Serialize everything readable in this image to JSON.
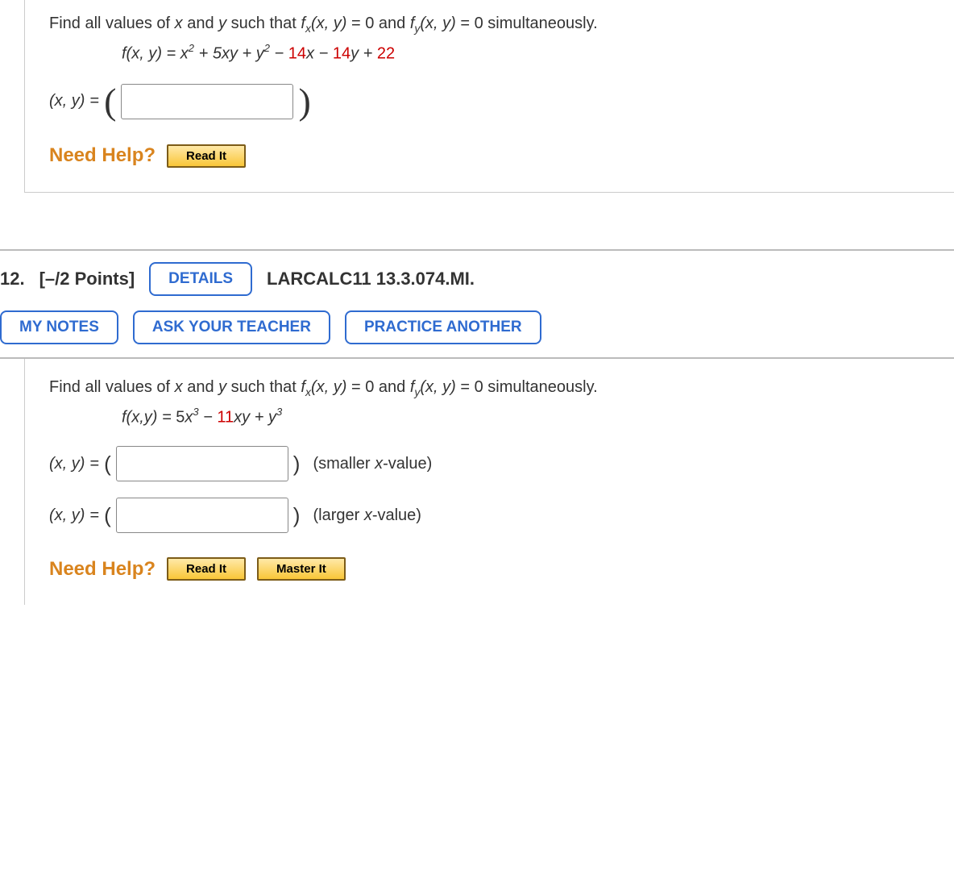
{
  "q11": {
    "prompt_before": "Find all values of ",
    "var_x": "x",
    "and1": " and ",
    "var_y": "y",
    "prompt_mid": " such that ",
    "fx": "f",
    "fx_sub": "x",
    "args": "(x, y)",
    "eq0_1": " = 0 and ",
    "fy": "f",
    "fy_sub": "y",
    "eq0_2": " = 0 simultaneously.",
    "eq_lhs": "f(x, y) = ",
    "eq_term1": "x",
    "eq_term2": " + 5xy + ",
    "eq_term3": "y",
    "eq_term4": " − ",
    "eq_c1": "14",
    "eq_term5": "x − ",
    "eq_c2": "14",
    "eq_term6": "y + ",
    "eq_c3": "22",
    "answer_label": "(x, y)",
    "equals": " = ",
    "need_help": "Need Help?",
    "read_it": "Read It"
  },
  "q12": {
    "number": "12.",
    "points": "[–/2 Points]",
    "details": "DETAILS",
    "ref": "LARCALC11 13.3.074.MI.",
    "my_notes": "MY NOTES",
    "ask_teacher": "ASK YOUR TEACHER",
    "practice_another": "PRACTICE ANOTHER",
    "prompt_before": "Find all values of ",
    "var_x": "x",
    "and1": " and ",
    "var_y": "y",
    "prompt_mid": " such that ",
    "fx": "f",
    "fx_sub": "x",
    "args": "(x, y)",
    "eq0_1": " = 0 and ",
    "fy": "f",
    "fy_sub": "y",
    "eq0_2": " = 0 simultaneously.",
    "eq_lhs": "f(x,y) = ",
    "eq_t1": "5",
    "eq_t2": "x",
    "eq_t3": " − ",
    "eq_c1": "11",
    "eq_t4": "xy + ",
    "eq_t5": "y",
    "answer_label": "(x, y)",
    "equals": " = ",
    "open_p": "(",
    "close_p": ")",
    "hint_small": "(smaller x-value)",
    "hint_large": "(larger x-value)",
    "need_help": "Need Help?",
    "read_it": "Read It",
    "master_it": "Master It"
  }
}
